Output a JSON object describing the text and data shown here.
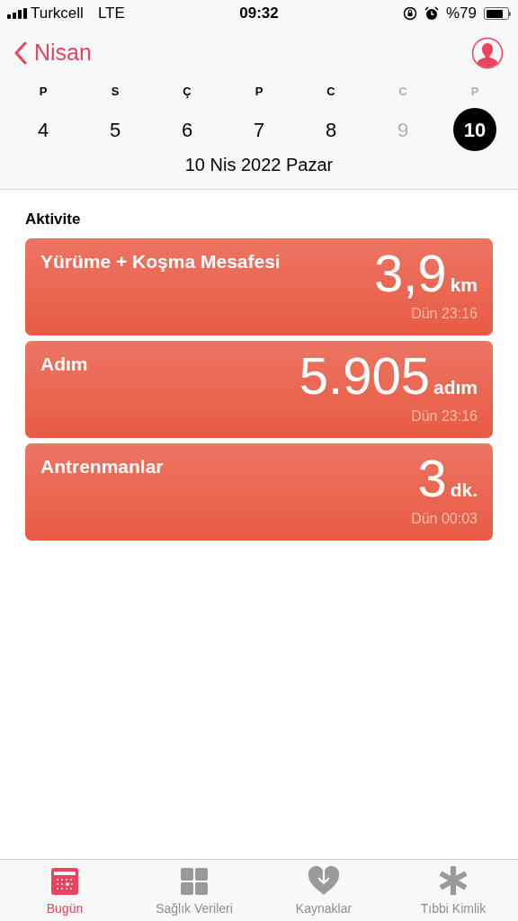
{
  "status_bar": {
    "carrier": "Turkcell",
    "network": "LTE",
    "time": "09:32",
    "battery_text": "%79"
  },
  "nav": {
    "back_label": "Nisan"
  },
  "week": [
    {
      "letter": "P",
      "day": "4",
      "dimmed": false,
      "selected": false
    },
    {
      "letter": "S",
      "day": "5",
      "dimmed": false,
      "selected": false
    },
    {
      "letter": "Ç",
      "day": "6",
      "dimmed": false,
      "selected": false
    },
    {
      "letter": "P",
      "day": "7",
      "dimmed": false,
      "selected": false
    },
    {
      "letter": "C",
      "day": "8",
      "dimmed": false,
      "selected": false
    },
    {
      "letter": "C",
      "day": "9",
      "dimmed": true,
      "selected": false
    },
    {
      "letter": "P",
      "day": "10",
      "dimmed": true,
      "selected": true
    }
  ],
  "date_label": "10 Nis 2022 Pazar",
  "section_title": "Aktivite",
  "cards": [
    {
      "title": "Yürüme + Koşma Mesafesi",
      "value": "3,9",
      "unit": "km",
      "time": "Dün 23:16"
    },
    {
      "title": "Adım",
      "value": "5.905",
      "unit": "adım",
      "time": "Dün 23:16"
    },
    {
      "title": "Antrenmanlar",
      "value": "3",
      "unit": "dk.",
      "time": "Dün 00:03"
    }
  ],
  "tabs": [
    {
      "label": "Bugün",
      "kind": "calendar",
      "selected": true
    },
    {
      "label": "Sağlık Verileri",
      "kind": "grid",
      "selected": false
    },
    {
      "label": "Kaynaklar",
      "kind": "heart",
      "selected": false
    },
    {
      "label": "Tıbbi Kimlik",
      "kind": "asterisk",
      "selected": false
    }
  ]
}
